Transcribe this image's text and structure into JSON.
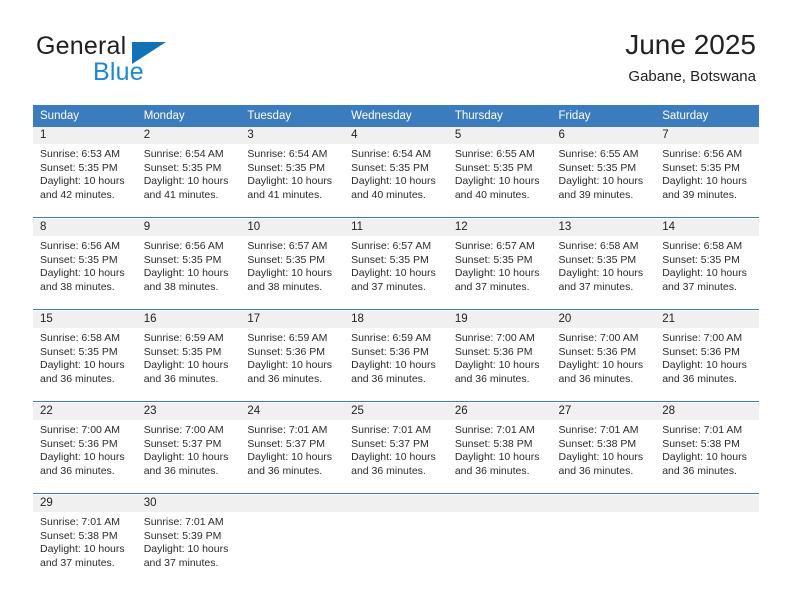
{
  "brand": {
    "name_part1": "General",
    "name_part2": "Blue",
    "triangle_color": "#1272b8",
    "part1_color": "#231f20",
    "part2_color": "#1b8ad4"
  },
  "header": {
    "title": "June 2025",
    "subtitle": "Gabane, Botswana"
  },
  "theme": {
    "header_bg": "#3b7cbf",
    "header_text": "#ffffff",
    "daynum_bg": "#f0f0f0",
    "separator": "#3b7cbf"
  },
  "weekday_headers": [
    "Sunday",
    "Monday",
    "Tuesday",
    "Wednesday",
    "Thursday",
    "Friday",
    "Saturday"
  ],
  "weeks": [
    [
      {
        "day": "1",
        "sunrise": "Sunrise: 6:53 AM",
        "sunset": "Sunset: 5:35 PM",
        "daylight_line1": "Daylight: 10 hours",
        "daylight_line2": "and 42 minutes."
      },
      {
        "day": "2",
        "sunrise": "Sunrise: 6:54 AM",
        "sunset": "Sunset: 5:35 PM",
        "daylight_line1": "Daylight: 10 hours",
        "daylight_line2": "and 41 minutes."
      },
      {
        "day": "3",
        "sunrise": "Sunrise: 6:54 AM",
        "sunset": "Sunset: 5:35 PM",
        "daylight_line1": "Daylight: 10 hours",
        "daylight_line2": "and 41 minutes."
      },
      {
        "day": "4",
        "sunrise": "Sunrise: 6:54 AM",
        "sunset": "Sunset: 5:35 PM",
        "daylight_line1": "Daylight: 10 hours",
        "daylight_line2": "and 40 minutes."
      },
      {
        "day": "5",
        "sunrise": "Sunrise: 6:55 AM",
        "sunset": "Sunset: 5:35 PM",
        "daylight_line1": "Daylight: 10 hours",
        "daylight_line2": "and 40 minutes."
      },
      {
        "day": "6",
        "sunrise": "Sunrise: 6:55 AM",
        "sunset": "Sunset: 5:35 PM",
        "daylight_line1": "Daylight: 10 hours",
        "daylight_line2": "and 39 minutes."
      },
      {
        "day": "7",
        "sunrise": "Sunrise: 6:56 AM",
        "sunset": "Sunset: 5:35 PM",
        "daylight_line1": "Daylight: 10 hours",
        "daylight_line2": "and 39 minutes."
      }
    ],
    [
      {
        "day": "8",
        "sunrise": "Sunrise: 6:56 AM",
        "sunset": "Sunset: 5:35 PM",
        "daylight_line1": "Daylight: 10 hours",
        "daylight_line2": "and 38 minutes."
      },
      {
        "day": "9",
        "sunrise": "Sunrise: 6:56 AM",
        "sunset": "Sunset: 5:35 PM",
        "daylight_line1": "Daylight: 10 hours",
        "daylight_line2": "and 38 minutes."
      },
      {
        "day": "10",
        "sunrise": "Sunrise: 6:57 AM",
        "sunset": "Sunset: 5:35 PM",
        "daylight_line1": "Daylight: 10 hours",
        "daylight_line2": "and 38 minutes."
      },
      {
        "day": "11",
        "sunrise": "Sunrise: 6:57 AM",
        "sunset": "Sunset: 5:35 PM",
        "daylight_line1": "Daylight: 10 hours",
        "daylight_line2": "and 37 minutes."
      },
      {
        "day": "12",
        "sunrise": "Sunrise: 6:57 AM",
        "sunset": "Sunset: 5:35 PM",
        "daylight_line1": "Daylight: 10 hours",
        "daylight_line2": "and 37 minutes."
      },
      {
        "day": "13",
        "sunrise": "Sunrise: 6:58 AM",
        "sunset": "Sunset: 5:35 PM",
        "daylight_line1": "Daylight: 10 hours",
        "daylight_line2": "and 37 minutes."
      },
      {
        "day": "14",
        "sunrise": "Sunrise: 6:58 AM",
        "sunset": "Sunset: 5:35 PM",
        "daylight_line1": "Daylight: 10 hours",
        "daylight_line2": "and 37 minutes."
      }
    ],
    [
      {
        "day": "15",
        "sunrise": "Sunrise: 6:58 AM",
        "sunset": "Sunset: 5:35 PM",
        "daylight_line1": "Daylight: 10 hours",
        "daylight_line2": "and 36 minutes."
      },
      {
        "day": "16",
        "sunrise": "Sunrise: 6:59 AM",
        "sunset": "Sunset: 5:35 PM",
        "daylight_line1": "Daylight: 10 hours",
        "daylight_line2": "and 36 minutes."
      },
      {
        "day": "17",
        "sunrise": "Sunrise: 6:59 AM",
        "sunset": "Sunset: 5:36 PM",
        "daylight_line1": "Daylight: 10 hours",
        "daylight_line2": "and 36 minutes."
      },
      {
        "day": "18",
        "sunrise": "Sunrise: 6:59 AM",
        "sunset": "Sunset: 5:36 PM",
        "daylight_line1": "Daylight: 10 hours",
        "daylight_line2": "and 36 minutes."
      },
      {
        "day": "19",
        "sunrise": "Sunrise: 7:00 AM",
        "sunset": "Sunset: 5:36 PM",
        "daylight_line1": "Daylight: 10 hours",
        "daylight_line2": "and 36 minutes."
      },
      {
        "day": "20",
        "sunrise": "Sunrise: 7:00 AM",
        "sunset": "Sunset: 5:36 PM",
        "daylight_line1": "Daylight: 10 hours",
        "daylight_line2": "and 36 minutes."
      },
      {
        "day": "21",
        "sunrise": "Sunrise: 7:00 AM",
        "sunset": "Sunset: 5:36 PM",
        "daylight_line1": "Daylight: 10 hours",
        "daylight_line2": "and 36 minutes."
      }
    ],
    [
      {
        "day": "22",
        "sunrise": "Sunrise: 7:00 AM",
        "sunset": "Sunset: 5:36 PM",
        "daylight_line1": "Daylight: 10 hours",
        "daylight_line2": "and 36 minutes."
      },
      {
        "day": "23",
        "sunrise": "Sunrise: 7:00 AM",
        "sunset": "Sunset: 5:37 PM",
        "daylight_line1": "Daylight: 10 hours",
        "daylight_line2": "and 36 minutes."
      },
      {
        "day": "24",
        "sunrise": "Sunrise: 7:01 AM",
        "sunset": "Sunset: 5:37 PM",
        "daylight_line1": "Daylight: 10 hours",
        "daylight_line2": "and 36 minutes."
      },
      {
        "day": "25",
        "sunrise": "Sunrise: 7:01 AM",
        "sunset": "Sunset: 5:37 PM",
        "daylight_line1": "Daylight: 10 hours",
        "daylight_line2": "and 36 minutes."
      },
      {
        "day": "26",
        "sunrise": "Sunrise: 7:01 AM",
        "sunset": "Sunset: 5:38 PM",
        "daylight_line1": "Daylight: 10 hours",
        "daylight_line2": "and 36 minutes."
      },
      {
        "day": "27",
        "sunrise": "Sunrise: 7:01 AM",
        "sunset": "Sunset: 5:38 PM",
        "daylight_line1": "Daylight: 10 hours",
        "daylight_line2": "and 36 minutes."
      },
      {
        "day": "28",
        "sunrise": "Sunrise: 7:01 AM",
        "sunset": "Sunset: 5:38 PM",
        "daylight_line1": "Daylight: 10 hours",
        "daylight_line2": "and 36 minutes."
      }
    ],
    [
      {
        "day": "29",
        "sunrise": "Sunrise: 7:01 AM",
        "sunset": "Sunset: 5:38 PM",
        "daylight_line1": "Daylight: 10 hours",
        "daylight_line2": "and 37 minutes."
      },
      {
        "day": "30",
        "sunrise": "Sunrise: 7:01 AM",
        "sunset": "Sunset: 5:39 PM",
        "daylight_line1": "Daylight: 10 hours",
        "daylight_line2": "and 37 minutes."
      },
      {
        "day": "",
        "sunrise": "",
        "sunset": "",
        "daylight_line1": "",
        "daylight_line2": ""
      },
      {
        "day": "",
        "sunrise": "",
        "sunset": "",
        "daylight_line1": "",
        "daylight_line2": ""
      },
      {
        "day": "",
        "sunrise": "",
        "sunset": "",
        "daylight_line1": "",
        "daylight_line2": ""
      },
      {
        "day": "",
        "sunrise": "",
        "sunset": "",
        "daylight_line1": "",
        "daylight_line2": ""
      },
      {
        "day": "",
        "sunrise": "",
        "sunset": "",
        "daylight_line1": "",
        "daylight_line2": ""
      }
    ]
  ]
}
